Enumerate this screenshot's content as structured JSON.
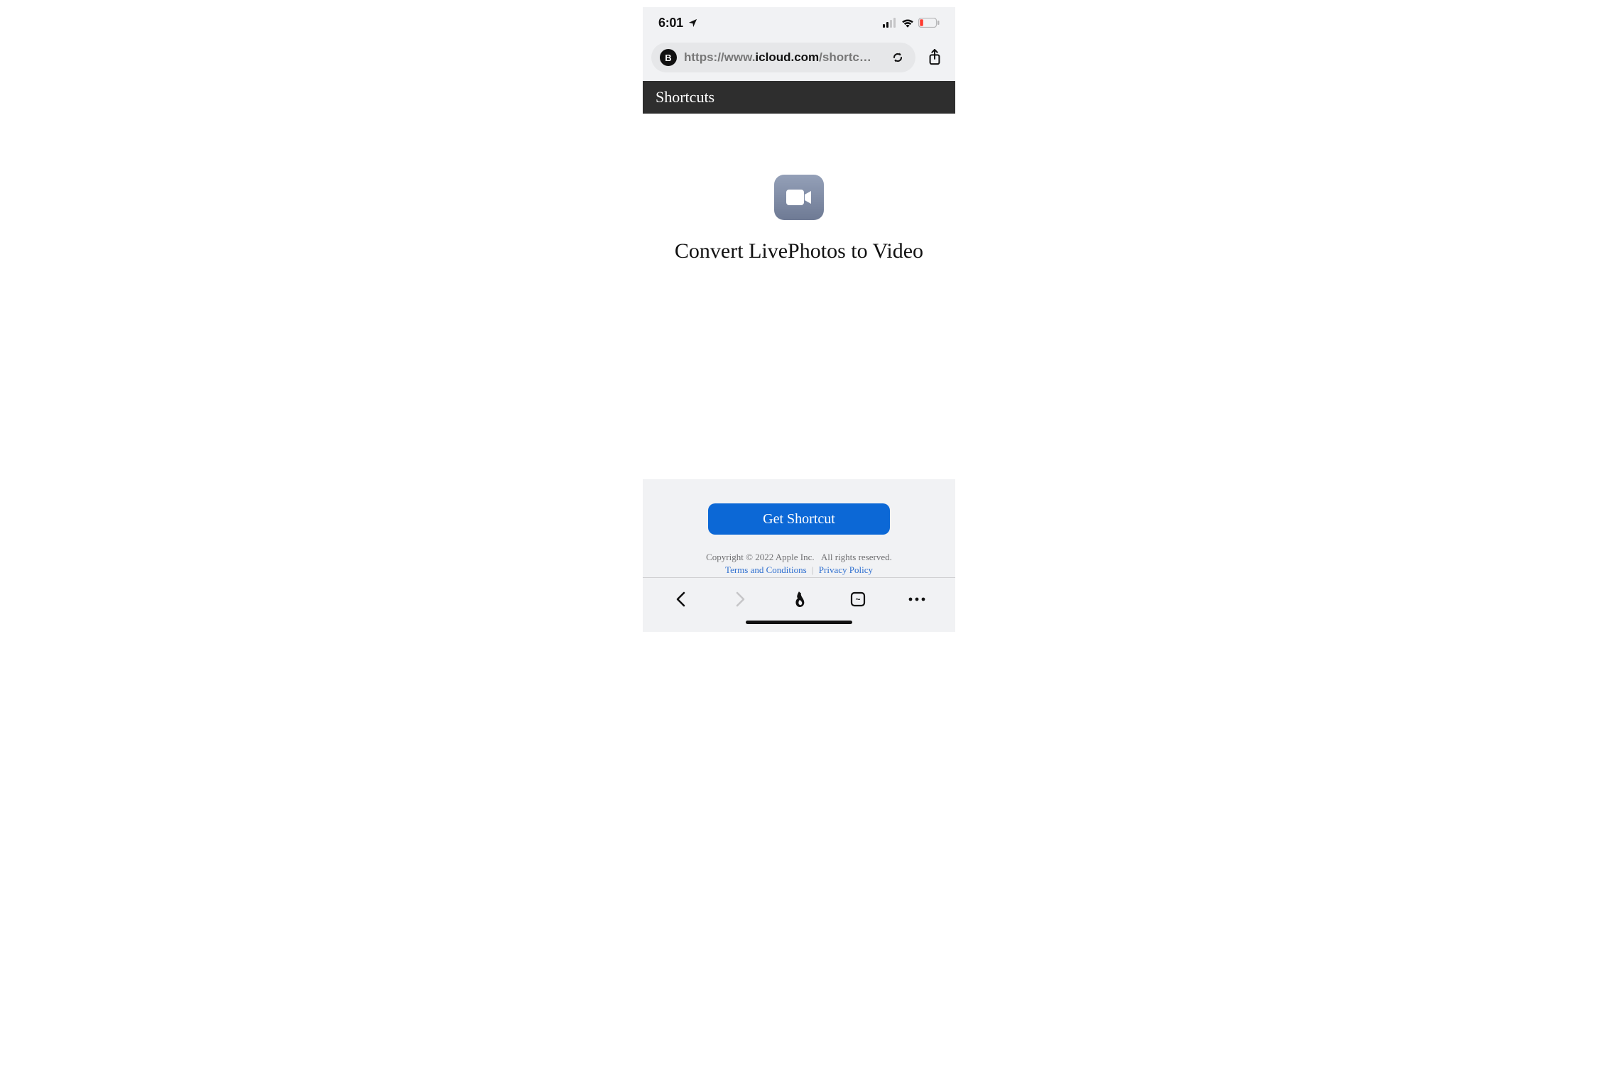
{
  "status": {
    "time": "6:01"
  },
  "url_bar": {
    "badge_letter": "B",
    "domain_prefix": "https://www.",
    "domain": "icloud.com",
    "path_truncated": "/shortc"
  },
  "header": {
    "title": "Shortcuts"
  },
  "main": {
    "shortcut_name": "Convert LivePhotos to Video"
  },
  "cta": {
    "get_label": "Get Shortcut"
  },
  "legal": {
    "copyright": "Copyright © 2022 Apple Inc.",
    "rights": "All rights reserved.",
    "terms_label": "Terms and Conditions",
    "privacy_label": "Privacy Policy"
  },
  "toolbar": {
    "tab_count": "~"
  }
}
